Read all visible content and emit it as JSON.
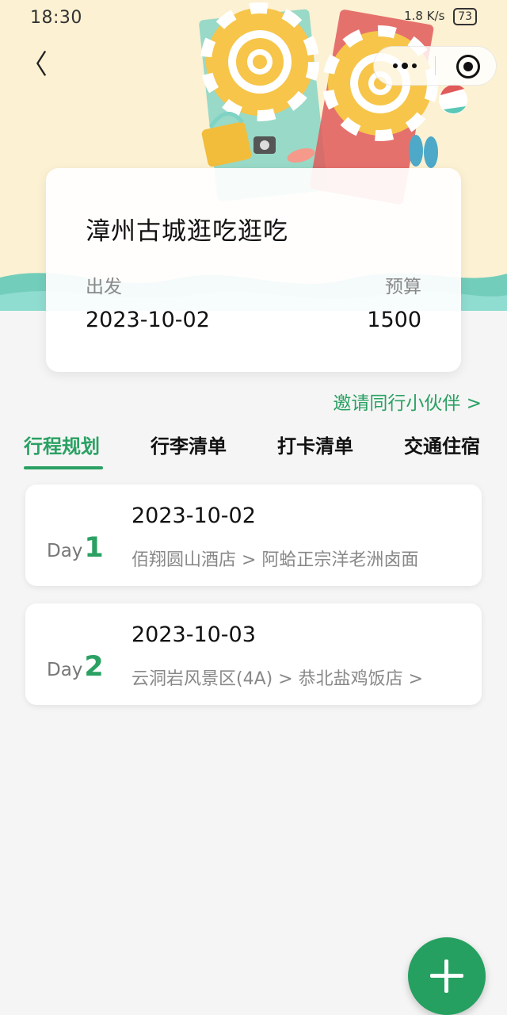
{
  "status_bar": {
    "time": "18:30",
    "network_speed": "1.8 K/s",
    "battery": "73"
  },
  "nav": {
    "back_icon": "back-chevron-icon",
    "more_icon": "more-dots-icon",
    "target_icon": "target-circle-icon"
  },
  "trip": {
    "title": "漳州古城逛吃逛吃",
    "depart_label": "出发",
    "depart_value": "2023-10-02",
    "budget_label": "预算",
    "budget_value": "1500"
  },
  "invite_link": "邀请同行小伙伴 >",
  "tabs": [
    {
      "label": "行程规划",
      "active": true
    },
    {
      "label": "行李清单",
      "active": false
    },
    {
      "label": "打卡清单",
      "active": false
    },
    {
      "label": "交通住宿",
      "active": false
    }
  ],
  "days": [
    {
      "prefix": "Day",
      "num": "1",
      "date": "2023-10-02",
      "route": "佰翔圆山酒店 > 阿蛤正宗洋老洲卤面"
    },
    {
      "prefix": "Day",
      "num": "2",
      "date": "2023-10-03",
      "route": "云洞岩风景区(4A) > 恭北盐鸡饭店 >"
    }
  ],
  "colors": {
    "accent": "#2aa163",
    "hero_bg": "#fdf1d3",
    "wave": "#5bc7b6"
  },
  "fab_icon": "plus-icon"
}
